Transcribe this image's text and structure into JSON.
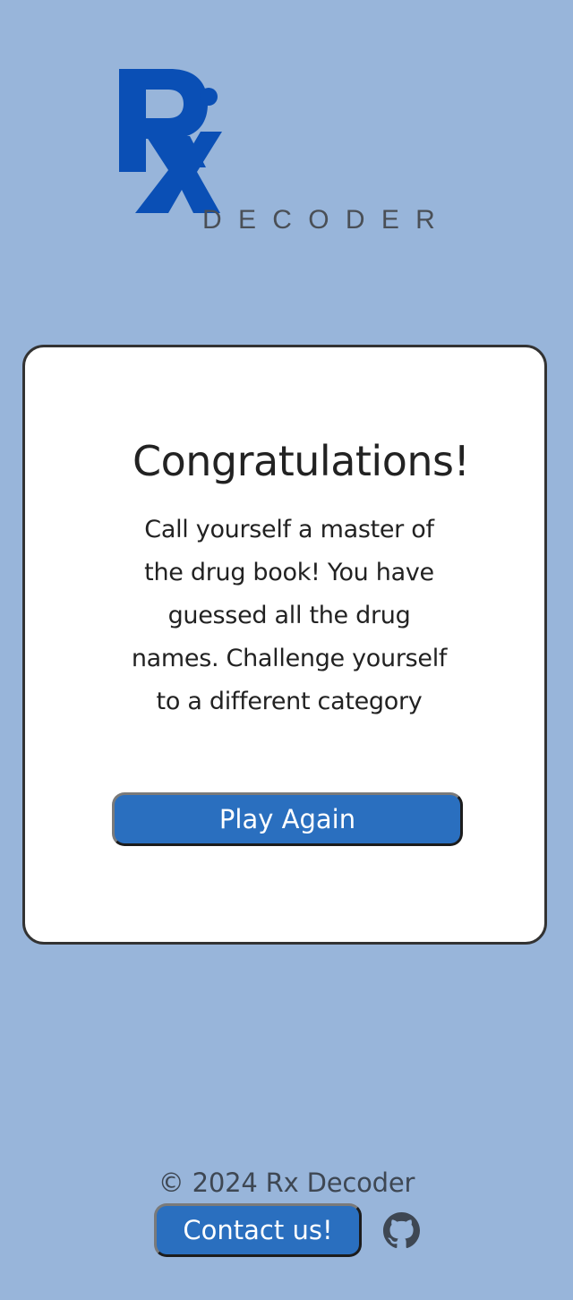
{
  "logo": {
    "mark": "Rx",
    "wordmark": "DECODER",
    "brand_color": "#0a4fb5",
    "wordmark_color": "#4a4f56"
  },
  "card": {
    "title": "Congratulations!",
    "message": "Call yourself a master of the drug book! You have guessed all the drug names. Challenge yourself to a different category",
    "play_again_label": "Play Again"
  },
  "footer": {
    "copyright": "© 2024 Rx Decoder",
    "contact_label": "Contact us!",
    "github_icon": "github-icon"
  },
  "colors": {
    "background": "#98b5da",
    "button": "#2a6fbf",
    "card": "#ffffff",
    "border": "#333333"
  }
}
